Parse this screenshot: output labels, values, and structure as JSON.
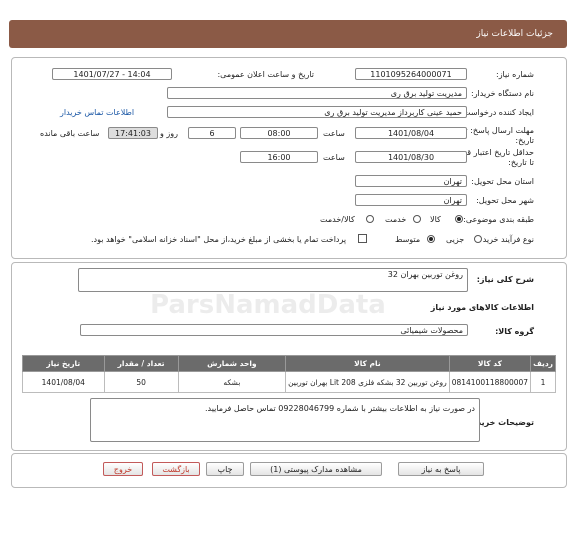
{
  "header": {
    "title": "جزئیات اطلاعات نیاز"
  },
  "info": {
    "need_number_label": "شماره نیاز:",
    "need_number": "1101095264000071",
    "announce_label": "تاریخ و ساعت اعلان عمومی:",
    "announce_value": "1401/07/27 - 14:04",
    "buyer_org_label": "نام دستگاه خریدار:",
    "buyer_org": "مدیریت تولید برق ری",
    "requester_label": "ایجاد کننده درخواست:",
    "requester": "حمید عینی کاربرداز مدیریت تولید برق ری",
    "contact_link": "اطلاعات تماس خریدار",
    "deadline_label": "مهلت ارسال پاسخ: تا تاریخ:",
    "deadline_date": "1401/08/04",
    "time_label": "ساعت",
    "deadline_time": "08:00",
    "days_value": "6",
    "days_label": "روز و",
    "remaining_time": "17:41:03",
    "remaining_label": "ساعت باقی مانده",
    "validity_label": "حداقل تاریخ اعتبار قیمت: تا تاریخ:",
    "validity_date": "1401/08/30",
    "validity_time": "16:00",
    "province_label": "استان محل تحویل:",
    "province": "تهران",
    "city_label": "شهر محل تحویل:",
    "city": "تهران",
    "category_label": "طبقه بندی موضوعی:",
    "category_options": [
      "کالا",
      "خدمت",
      "کالا/خدمت"
    ],
    "process_label": "نوع فرآیند خرید :",
    "process_options": [
      "جزیی",
      "متوسط"
    ],
    "payment_note": "پرداخت تمام یا بخشی از مبلغ خرید،از محل \"اسناد خزانه اسلامی\" خواهد بود."
  },
  "goods": {
    "description_label": "شرح کلی نیاز:",
    "description": "روغن توربین بهران 32",
    "section_title": "اطلاعات کالاهای مورد نیاز",
    "group_label": "گروه کالا:",
    "group_value": "محصولات شیمیائی",
    "columns": [
      "ردیف",
      "کد کالا",
      "نام کالا",
      "واحد شمارش",
      "تعداد / مقدار",
      "تاریخ نیاز"
    ],
    "rows": [
      [
        "1",
        "0814100118800007",
        "روغن توربین 32 بشکه فلزی 208 Lit بهران توربین",
        "بشکه",
        "50",
        "1401/08/04"
      ]
    ],
    "buyer_notes_label": "توضیحات خریدار:",
    "buyer_notes": "در صورت نیاز به اطلاعات بیشتر با شماره 09228046799 تماس حاصل فرمایید."
  },
  "buttons": {
    "respond": "پاسخ به نیاز",
    "view_docs": "مشاهده مدارک پیوستی (1)",
    "print": "چاپ",
    "back": "بازگشت",
    "exit": "خروج"
  },
  "watermark": {
    "brand": "ParsNamadData"
  }
}
